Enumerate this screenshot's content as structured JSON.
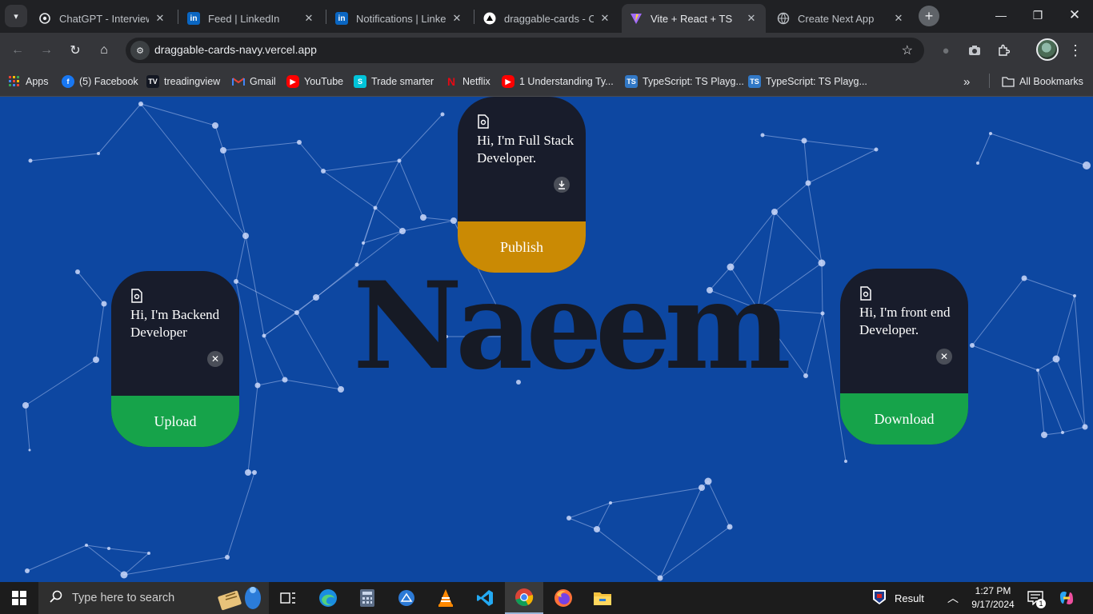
{
  "browser": {
    "tabs": [
      {
        "title": "ChatGPT - Interview S",
        "favicon": "chatgpt-icon"
      },
      {
        "title": "Feed | LinkedIn",
        "favicon": "linkedin-icon"
      },
      {
        "title": "Notifications | LinkedI",
        "favicon": "linkedin-icon"
      },
      {
        "title": "draggable-cards - Ov",
        "favicon": "vercel-icon"
      },
      {
        "title": "Vite + React + TS",
        "favicon": "vite-icon",
        "active": true
      },
      {
        "title": "Create Next App",
        "favicon": "globe-icon"
      }
    ],
    "url": "draggable-cards-navy.vercel.app",
    "bookmarks": [
      {
        "label": "Apps",
        "icon": "apps-grid-icon"
      },
      {
        "label": "(5) Facebook",
        "icon": "facebook-icon"
      },
      {
        "label": "treadingview",
        "icon": "tradingview-icon"
      },
      {
        "label": "Gmail",
        "icon": "gmail-icon"
      },
      {
        "label": "YouTube",
        "icon": "youtube-icon"
      },
      {
        "label": "Trade smarter",
        "icon": "trade-icon"
      },
      {
        "label": "Netflix",
        "icon": "netflix-icon"
      },
      {
        "label": "1 Understanding Ty...",
        "icon": "youtube-icon"
      },
      {
        "label": "TypeScript: TS Playg...",
        "icon": "typescript-icon"
      },
      {
        "label": "TypeScript: TS Playg...",
        "icon": "typescript-icon"
      }
    ],
    "all_bookmarks": "All Bookmarks"
  },
  "page": {
    "hero_text": "Naeem",
    "background_color": "#0d47a1",
    "cards": [
      {
        "text": "Hi, I'm Backend Developer",
        "footer": "Upload",
        "footer_color": "#16a34a",
        "action_icon": "close-icon"
      },
      {
        "text": "Hi, I'm Full Stack Developer.",
        "footer": "Publish",
        "footer_color": "#ca8a04",
        "action_icon": "download-icon"
      },
      {
        "text": "Hi, I'm front end Developer.",
        "footer": "Download",
        "footer_color": "#16a34a",
        "action_icon": "close-icon"
      }
    ]
  },
  "taskbar": {
    "search_placeholder": "Type here to search",
    "weather": "Result",
    "time": "1:27 PM",
    "date": "9/17/2024",
    "notification_count": "1"
  }
}
